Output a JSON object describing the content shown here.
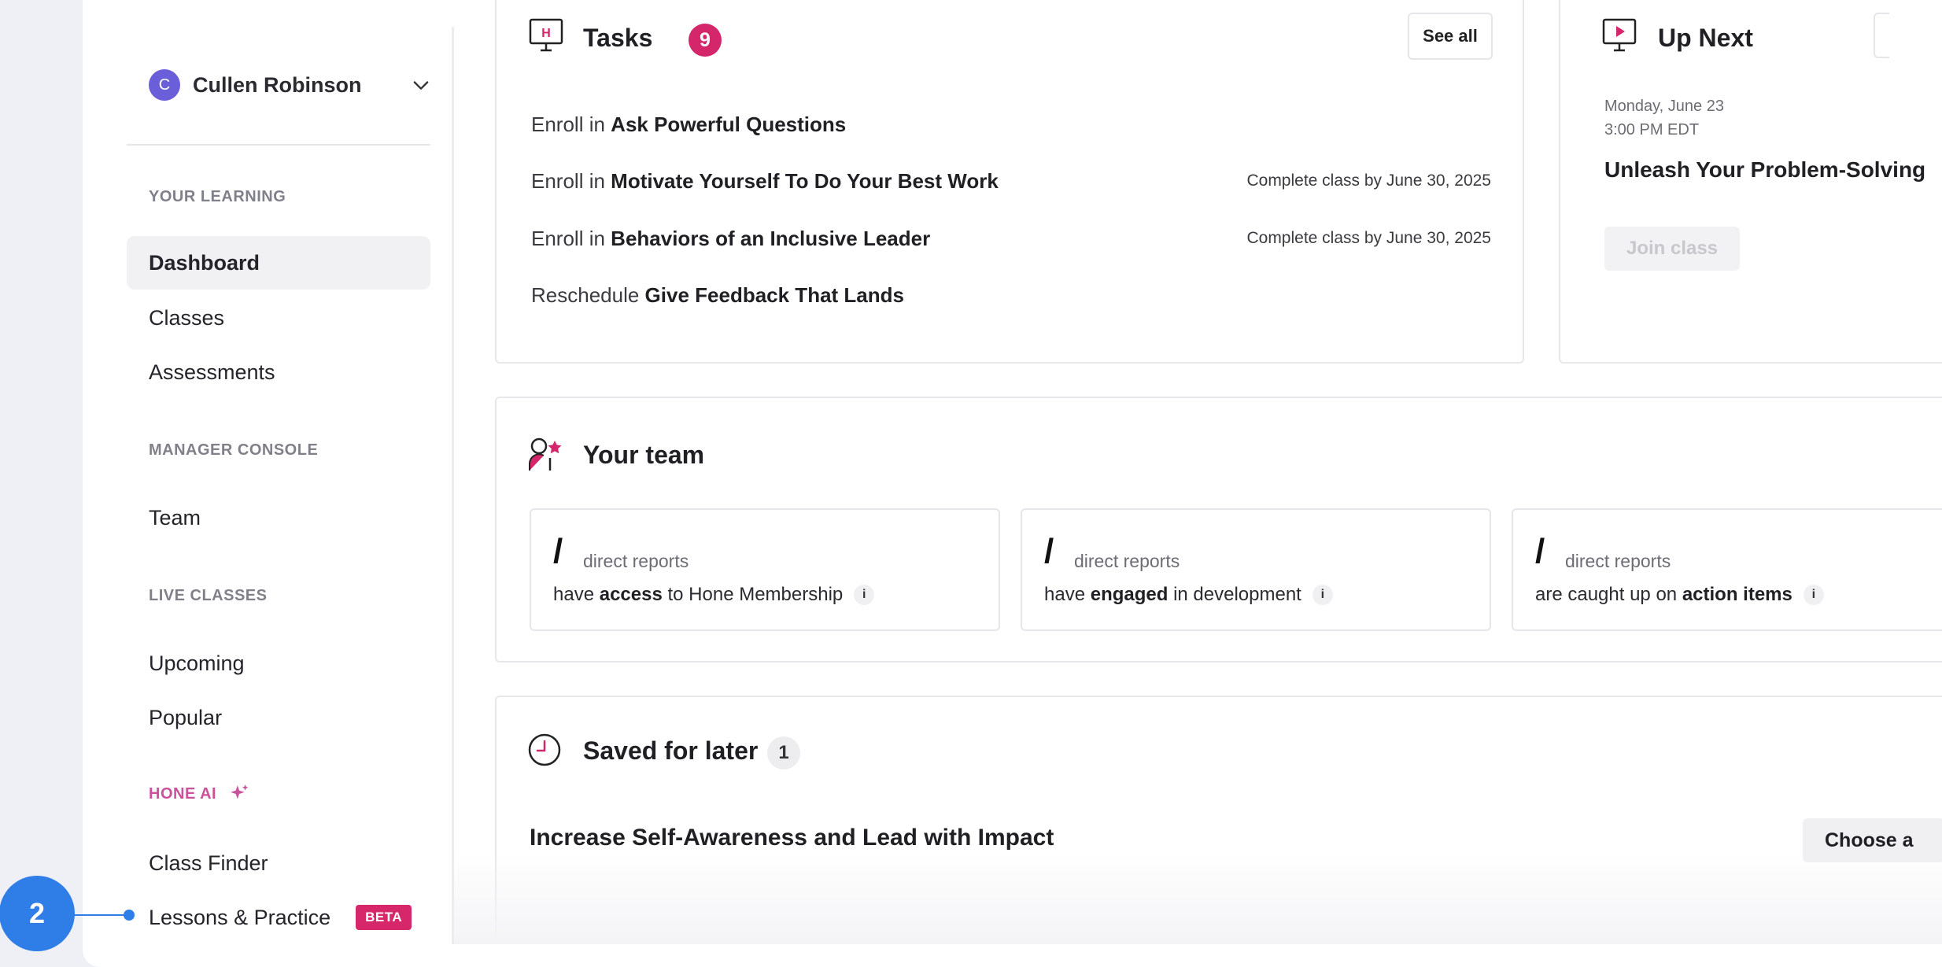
{
  "user": {
    "initial": "C",
    "name": "Cullen Robinson"
  },
  "sidebar": {
    "sections": [
      {
        "label": "YOUR LEARNING"
      },
      {
        "label": "MANAGER CONSOLE"
      },
      {
        "label": "LIVE CLASSES"
      },
      {
        "label": "HONE AI"
      }
    ],
    "items": {
      "dashboard": "Dashboard",
      "classes": "Classes",
      "assessments": "Assessments",
      "team": "Team",
      "upcoming": "Upcoming",
      "popular": "Popular",
      "class_finder": "Class Finder",
      "lessons_practice": "Lessons & Practice"
    },
    "beta_badge": "BETA"
  },
  "tasks": {
    "title": "Tasks",
    "count": "9",
    "see_all": "See all",
    "rows": [
      {
        "verb": "Enroll in",
        "name": "Ask Powerful Questions",
        "due": ""
      },
      {
        "verb": "Enroll in",
        "name": "Motivate Yourself To Do Your Best Work",
        "due": "Complete class by June 30, 2025"
      },
      {
        "verb": "Enroll in",
        "name": "Behaviors of an Inclusive Leader",
        "due": "Complete class by June 30, 2025"
      },
      {
        "verb": "Reschedule",
        "name": "Give Feedback That Lands",
        "due": ""
      }
    ]
  },
  "up_next": {
    "title": "Up Next",
    "date": "Monday, June 23",
    "time": "3:00 PM EDT",
    "class_title": "Unleash Your Problem-Solving",
    "join": "Join class"
  },
  "team": {
    "title": "Your team",
    "stats": [
      {
        "slash": "/",
        "caption": "direct reports",
        "pre": "have",
        "bold": "access",
        "post": "to Hone Membership",
        "info": "i"
      },
      {
        "slash": "/",
        "caption": "direct reports",
        "pre": "have",
        "bold": "engaged",
        "post": "in development",
        "info": "i"
      },
      {
        "slash": "/",
        "caption": "direct reports",
        "pre": "are caught up on",
        "bold": "action items",
        "post": "",
        "info": "i"
      }
    ]
  },
  "saved": {
    "title": "Saved for later",
    "count": "1",
    "item": "Increase Self-Awareness and Lead with Impact",
    "choose": "Choose a"
  },
  "marker": {
    "number": "2"
  },
  "colors": {
    "accent_pink": "#d4266a",
    "marker_blue": "#2f7de6",
    "avatar_purple": "#6a5fd8"
  }
}
